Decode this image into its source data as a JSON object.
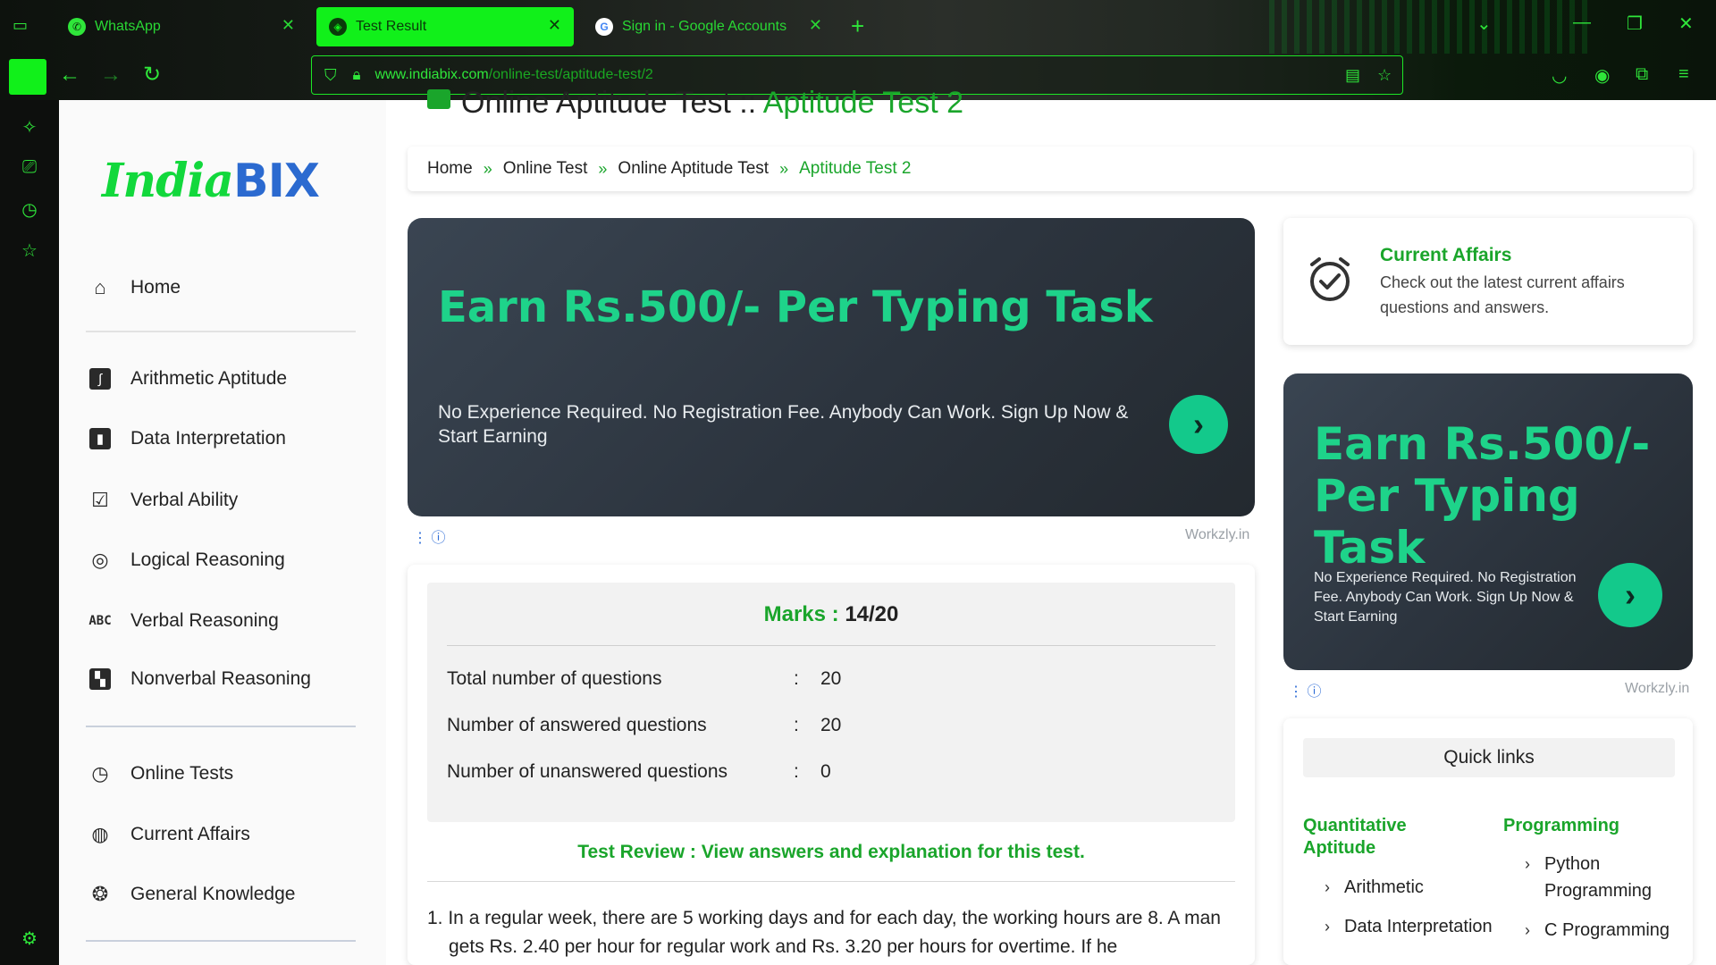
{
  "browser": {
    "tabs": [
      {
        "title": "WhatsApp",
        "active": false
      },
      {
        "title": "Test Result",
        "active": true
      },
      {
        "title": "Sign in - Google Accounts",
        "active": false
      }
    ],
    "url_host": "www.indiabix.com",
    "url_path": "/online-test/aptitude-test/2",
    "accent_color": "#11f01a"
  },
  "site": {
    "logo_text_1": "India",
    "logo_text_2": "BIX",
    "nav": [
      {
        "label": "Home",
        "icon": "home-icon"
      },
      {
        "label": "Arithmetic Aptitude",
        "icon": "integral-icon"
      },
      {
        "label": "Data Interpretation",
        "icon": "bar-chart-icon"
      },
      {
        "label": "Verbal Ability",
        "icon": "checklist-icon"
      },
      {
        "label": "Logical Reasoning",
        "icon": "aperture-icon"
      },
      {
        "label": "Verbal Reasoning",
        "icon": "abc-icon"
      },
      {
        "label": "Nonverbal Reasoning",
        "icon": "layout-icon"
      },
      {
        "label": "Online Tests",
        "icon": "clock-icon"
      },
      {
        "label": "Current Affairs",
        "icon": "globe-icon"
      },
      {
        "label": "General Knowledge",
        "icon": "lightbulb-head-icon"
      }
    ]
  },
  "page": {
    "title_prefix": "Online Aptitude Test :: ",
    "title_highlight": "Aptitude Test 2",
    "breadcrumb": [
      "Home",
      "Online Test",
      "Online Aptitude Test",
      "Aptitude Test 2"
    ],
    "breadcrumb_sep": "»"
  },
  "ad_main": {
    "headline": "Earn Rs.500/- Per Typing Task",
    "body": "No Experience Required. No Registration Fee. Anybody Can Work. Sign Up Now & Start Earning",
    "source": "Workzly.in"
  },
  "result": {
    "marks_label": "Marks : ",
    "marks_value": "14/20",
    "rows": [
      {
        "label": "Total number of questions",
        "value": "20"
      },
      {
        "label": "Number of answered questions",
        "value": "20"
      },
      {
        "label": "Number of unanswered questions",
        "value": "0"
      }
    ],
    "colon": ":",
    "review_link": "Test Review : View answers and explanation for this test.",
    "question_1": "1. In a regular week, there are 5 working days and for each day, the working hours are 8. A man gets Rs. 2.40 per hour for regular work and Rs. 3.20 per hours for overtime. If he"
  },
  "current_affairs": {
    "title": "Current Affairs",
    "desc": "Check out the latest current affairs questions and answers."
  },
  "ad_side": {
    "headline": "Earn Rs.500/- Per Typing Task",
    "body": "No Experience Required. No Registration Fee. Anybody Can Work. Sign Up Now & Start Earning",
    "source": "Workzly.in"
  },
  "quick_links": {
    "title": "Quick links",
    "col1_title": "Quantitative Aptitude",
    "col1_items": [
      "Arithmetic",
      "Data Interpretation"
    ],
    "col2_title": "Programming",
    "col2_items": [
      "Python Programming",
      "C Programming"
    ]
  }
}
